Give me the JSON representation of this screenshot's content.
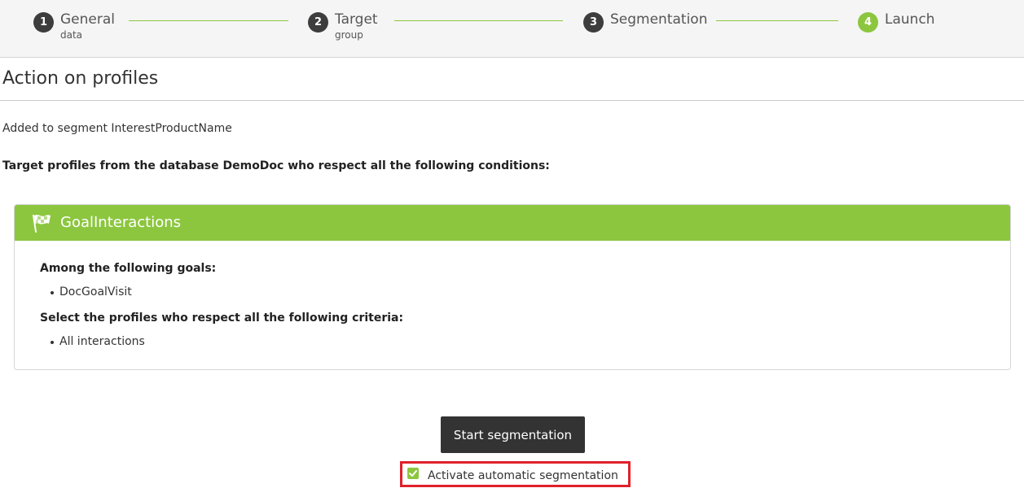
{
  "colors": {
    "accent": "#8cc63f",
    "dark": "#3d3d3d",
    "highlight": "#e0202a"
  },
  "wizard": {
    "steps": [
      {
        "number": "1",
        "title": "General",
        "subtitle": "data"
      },
      {
        "number": "2",
        "title": "Target",
        "subtitle": "group"
      },
      {
        "number": "3",
        "title": "Segmentation",
        "subtitle": ""
      },
      {
        "number": "4",
        "title": "Launch",
        "subtitle": "",
        "active": true
      }
    ]
  },
  "main": {
    "title": "Action on profiles",
    "added_text": "Added to segment InterestProductName",
    "target_text": "Target profiles from the database DemoDoc who respect all the following conditions:"
  },
  "panel": {
    "icon": "checkered-flag-icon",
    "title": "GoalInteractions",
    "goals_heading": "Among the following goals:",
    "goals": [
      "DocGoalVisit"
    ],
    "criteria_heading": "Select the profiles who respect all the following criteria:",
    "criteria": [
      "All interactions"
    ]
  },
  "actions": {
    "start_label": "Start segmentation",
    "auto_label": "Activate automatic segmentation",
    "auto_checked": true
  }
}
